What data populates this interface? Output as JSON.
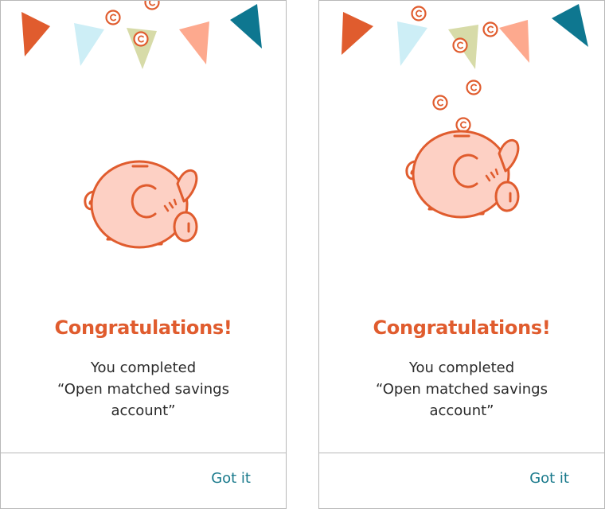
{
  "screens": [
    {
      "title": "Congratulations!",
      "message_line1": "You completed",
      "message_line2": "“Open matched savings",
      "message_line3": "account”",
      "button_label": "Got it"
    },
    {
      "title": "Congratulations!",
      "message_line1": "You completed",
      "message_line2": "“Open matched savings",
      "message_line3": "account”",
      "button_label": "Got it"
    }
  ],
  "colors": {
    "accent": "#e05c2e",
    "link": "#1a7a8c",
    "pig_fill": "#fdd0c4",
    "flag_red": "#e05c2e",
    "flag_light_blue": "#cdeef6",
    "flag_olive": "#d7dba8",
    "flag_salmon": "#fda98e",
    "flag_teal": "#0e7790"
  }
}
